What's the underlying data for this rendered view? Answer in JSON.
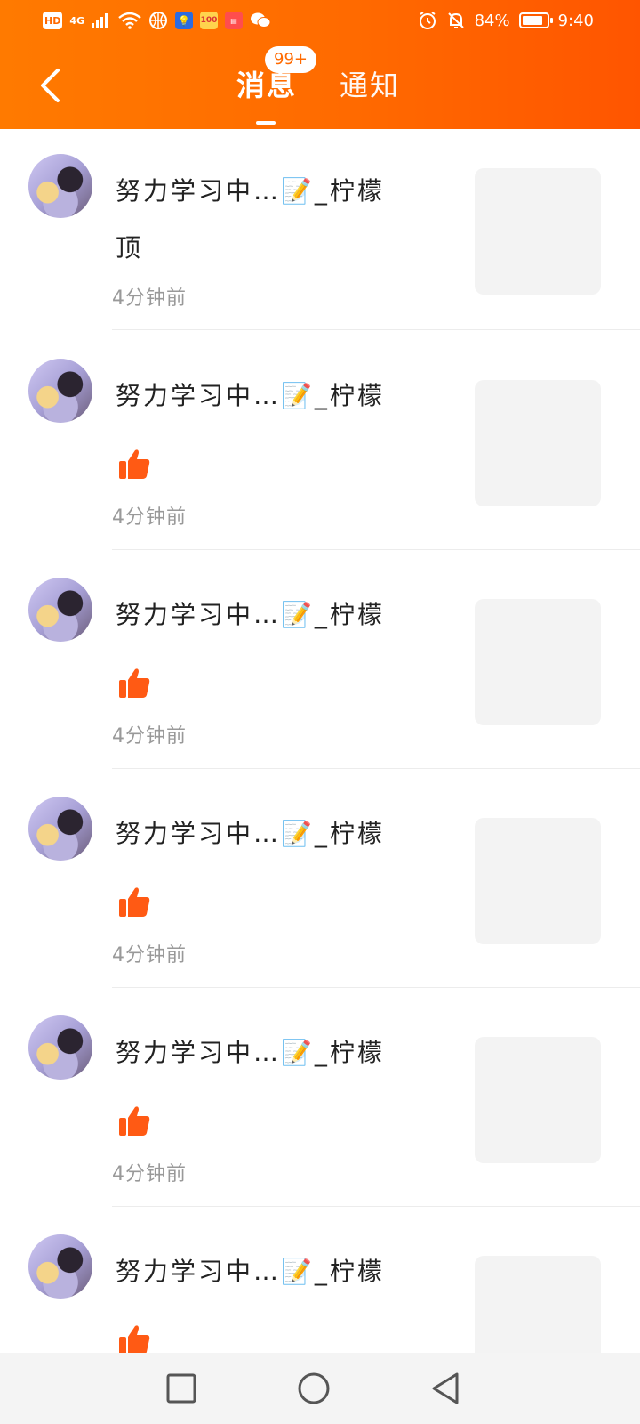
{
  "status_bar": {
    "left_icons": [
      "HD",
      "4G",
      "signal-icon",
      "wifi-icon",
      "basketball-icon",
      "bulb-app-icon",
      "100-app-icon",
      "red-app-icon",
      "wechat-icon"
    ],
    "battery_percent": "84%",
    "time": "9:40"
  },
  "nav": {
    "back_label": "",
    "tab_messages": "消息",
    "tab_notices": "通知",
    "badge": "99+"
  },
  "messages": [
    {
      "name": "努力学习中…📝_柠檬",
      "content_type": "text",
      "text": "顶",
      "time": "4分钟前"
    },
    {
      "name": "努力学习中…📝_柠檬",
      "content_type": "like",
      "text": "",
      "time": "4分钟前"
    },
    {
      "name": "努力学习中…📝_柠檬",
      "content_type": "like",
      "text": "",
      "time": "4分钟前"
    },
    {
      "name": "努力学习中…📝_柠檬",
      "content_type": "like",
      "text": "",
      "time": "4分钟前"
    },
    {
      "name": "努力学习中…📝_柠檬",
      "content_type": "like",
      "text": "",
      "time": "4分钟前"
    },
    {
      "name": "努力学习中…📝_柠檬",
      "content_type": "like",
      "text": "",
      "time": ""
    }
  ],
  "colors": {
    "header_start": "#ff7a00",
    "header_end": "#ff5500",
    "like": "#ff5a14",
    "time_text": "#999999"
  }
}
